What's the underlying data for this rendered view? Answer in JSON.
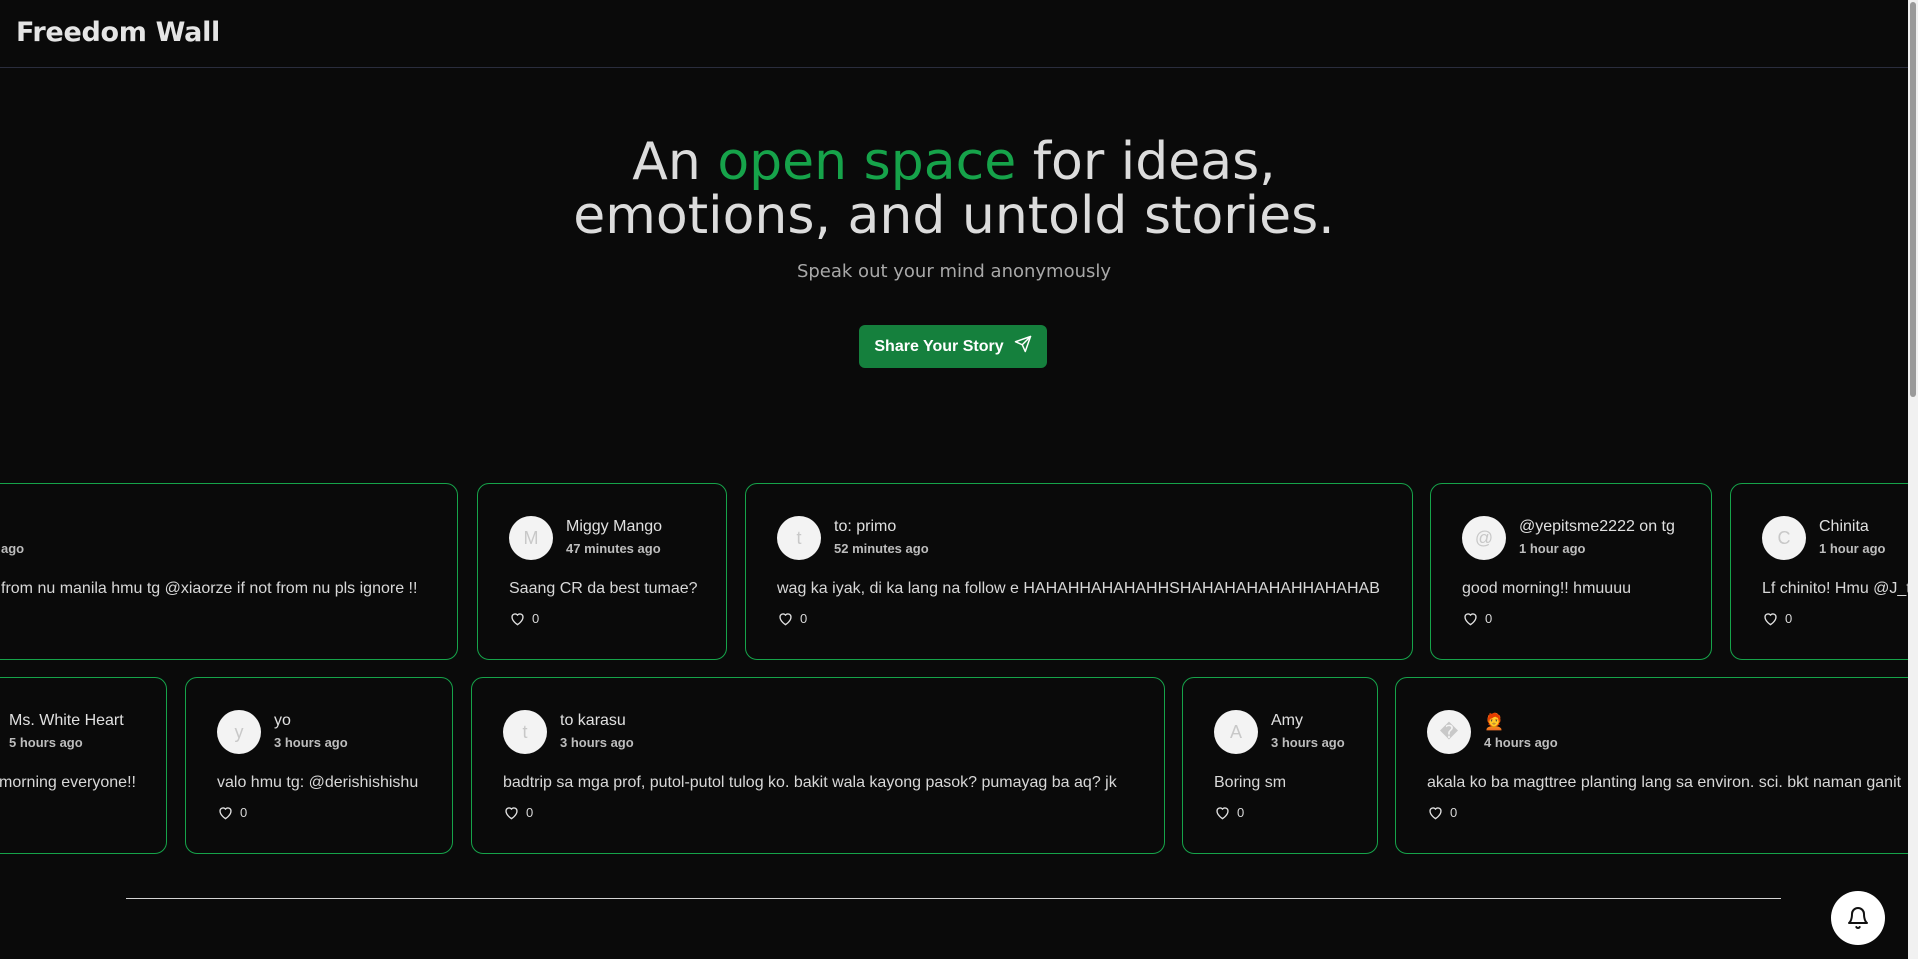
{
  "app": {
    "title": "Freedom Wall"
  },
  "hero": {
    "headline_part1": "An ",
    "headline_accent": "open space",
    "headline_part2": " for ideas,",
    "headline_line2": "emotions, and untold stories.",
    "tagline": "Speak out your mind anonymously",
    "cta_label": "Share Your Story",
    "accent_color": "#16a34a"
  },
  "posts_row1": [
    {
      "initial": "",
      "name": "",
      "time": "ago",
      "message": "from nu manila hmu tg @xiaorze if not from nu pls ignore !!",
      "likes": "0"
    },
    {
      "initial": "M",
      "name": "Miggy Mango",
      "time": "47 minutes ago",
      "message": "Saang CR da best tumae?",
      "likes": "0"
    },
    {
      "initial": "t",
      "name": "to: primo",
      "time": "52 minutes ago",
      "message": "wag ka iyak, di ka lang na follow e HAHAHHAHAHAHHSHAHAHAHAHAHHAHAHAB",
      "likes": "0"
    },
    {
      "initial": "@",
      "name": "@yepitsme2222 on tg",
      "time": "1 hour ago",
      "message": "good morning!! hmuuuu",
      "likes": "0"
    },
    {
      "initial": "C",
      "name": "Chinita",
      "time": "1 hour ago",
      "message": "Lf chinito! Hmu @J_t",
      "likes": "0"
    }
  ],
  "posts_row2": [
    {
      "initial": "",
      "name": "Ms. White Heart",
      "time": "5 hours ago",
      "message": "morning everyone!!",
      "likes": ""
    },
    {
      "initial": "y",
      "name": "yo",
      "time": "3 hours ago",
      "message": "valo hmu tg: @derishishishu",
      "likes": "0"
    },
    {
      "initial": "t",
      "name": "to karasu",
      "time": "3 hours ago",
      "message": "badtrip sa mga prof, putol-putol tulog ko. bakit wala kayong pasok? pumayag ba aq? jk",
      "likes": "0"
    },
    {
      "initial": "A",
      "name": "Amy",
      "time": "3 hours ago",
      "message": "Boring sm",
      "likes": "0"
    },
    {
      "initial": "�",
      "name": "🧑‍🦰",
      "time": "4 hours ago",
      "message": "akala ko ba magttree planting lang sa environ. sci. bkt naman ganit",
      "likes": "0"
    }
  ],
  "icons": {
    "send": "send-icon",
    "heart": "heart-icon",
    "bell": "bell-icon"
  }
}
